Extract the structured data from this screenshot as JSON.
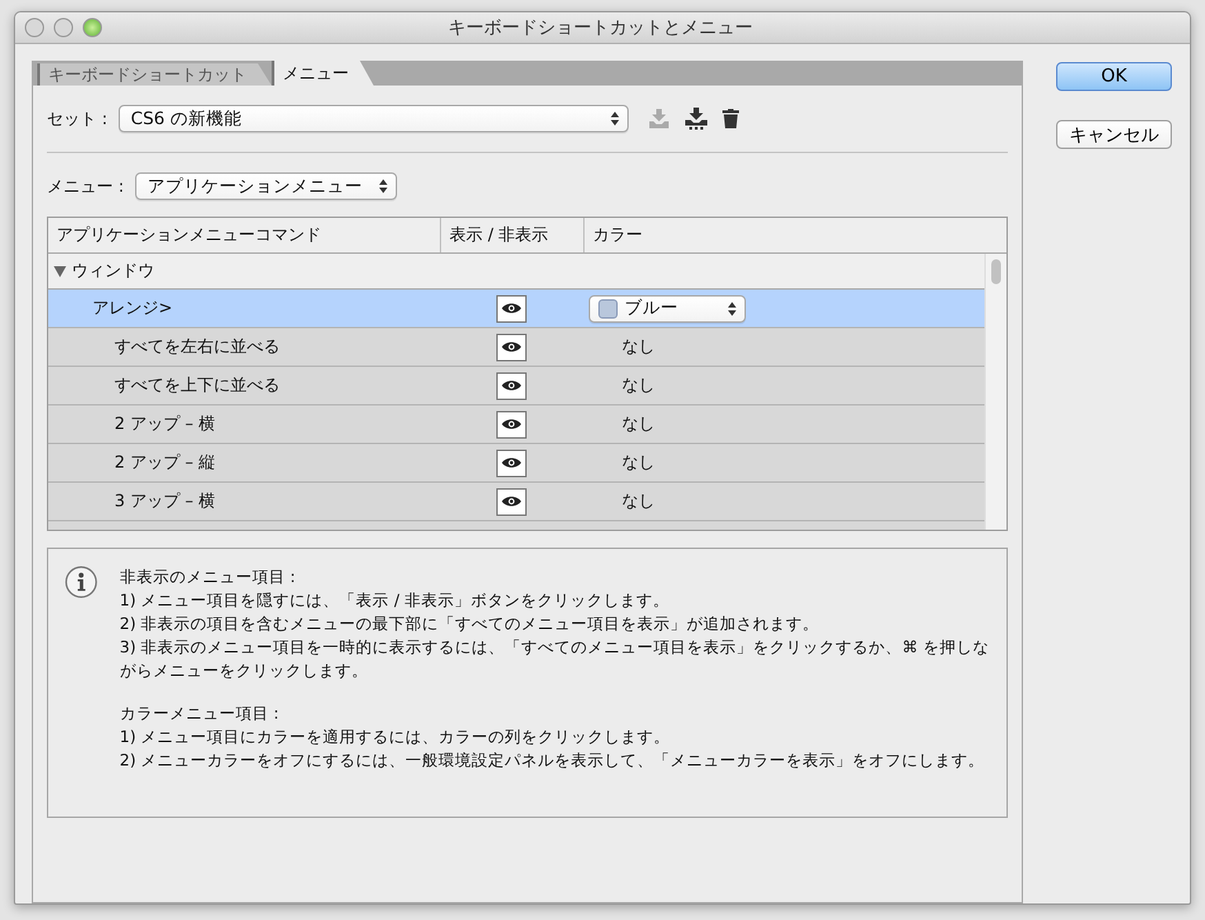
{
  "window": {
    "title": "キーボードショートカットとメニュー"
  },
  "tabs": [
    {
      "label": "キーボードショートカット",
      "selected": false
    },
    {
      "label": "メニュー",
      "selected": true
    }
  ],
  "set": {
    "label": "セット :",
    "value": "CS6 の新機能"
  },
  "menu": {
    "label": "メニュー :",
    "value": "アプリケーションメニュー"
  },
  "table": {
    "columns": [
      "アプリケーションメニューコマンド",
      "表示 / 非表示",
      "カラー"
    ],
    "group": {
      "label": "ウィンドウ",
      "expanded": true
    },
    "rows": [
      {
        "command": "アレンジ>",
        "selected": true,
        "visible": true,
        "kind": "dropdown",
        "color_label": "ブルー",
        "children": [
          {
            "command": "すべてを左右に並べる",
            "selected": false,
            "visible": true,
            "kind": "text",
            "color_label": "なし"
          },
          {
            "command": "すべてを上下に並べる",
            "selected": false,
            "visible": true,
            "kind": "text",
            "color_label": "なし"
          },
          {
            "command": "2 アップ – 横",
            "selected": false,
            "visible": true,
            "kind": "text",
            "color_label": "なし"
          },
          {
            "command": "2 アップ – 縦",
            "selected": false,
            "visible": true,
            "kind": "text",
            "color_label": "なし"
          },
          {
            "command": "3 アップ – 横",
            "selected": false,
            "visible": true,
            "kind": "text",
            "color_label": "なし"
          }
        ]
      }
    ]
  },
  "info": {
    "paragraphs": [
      [
        "非表示のメニュー項目 :",
        "1) メニュー項目を隠すには、「表示 / 非表示」ボタンをクリックします。",
        "2) 非表示の項目を含むメニューの最下部に「すべてのメニュー項目を表示」が追加されます。",
        "3) 非表示のメニュー項目を一時的に表示するには、「すべてのメニュー項目を表示」をクリックするか、⌘ を押しながらメニューをクリックします。"
      ],
      [
        "カラーメニュー項目 :",
        "1) メニュー項目にカラーを適用するには、カラーの列をクリックします。",
        "2) メニューカラーをオフにするには、一般環境設定パネルを表示して、「メニューカラーを表示」をオフにします。"
      ]
    ]
  },
  "buttons": [
    {
      "label": "OK",
      "default": true
    },
    {
      "label": "キャンセル",
      "default": false
    }
  ]
}
